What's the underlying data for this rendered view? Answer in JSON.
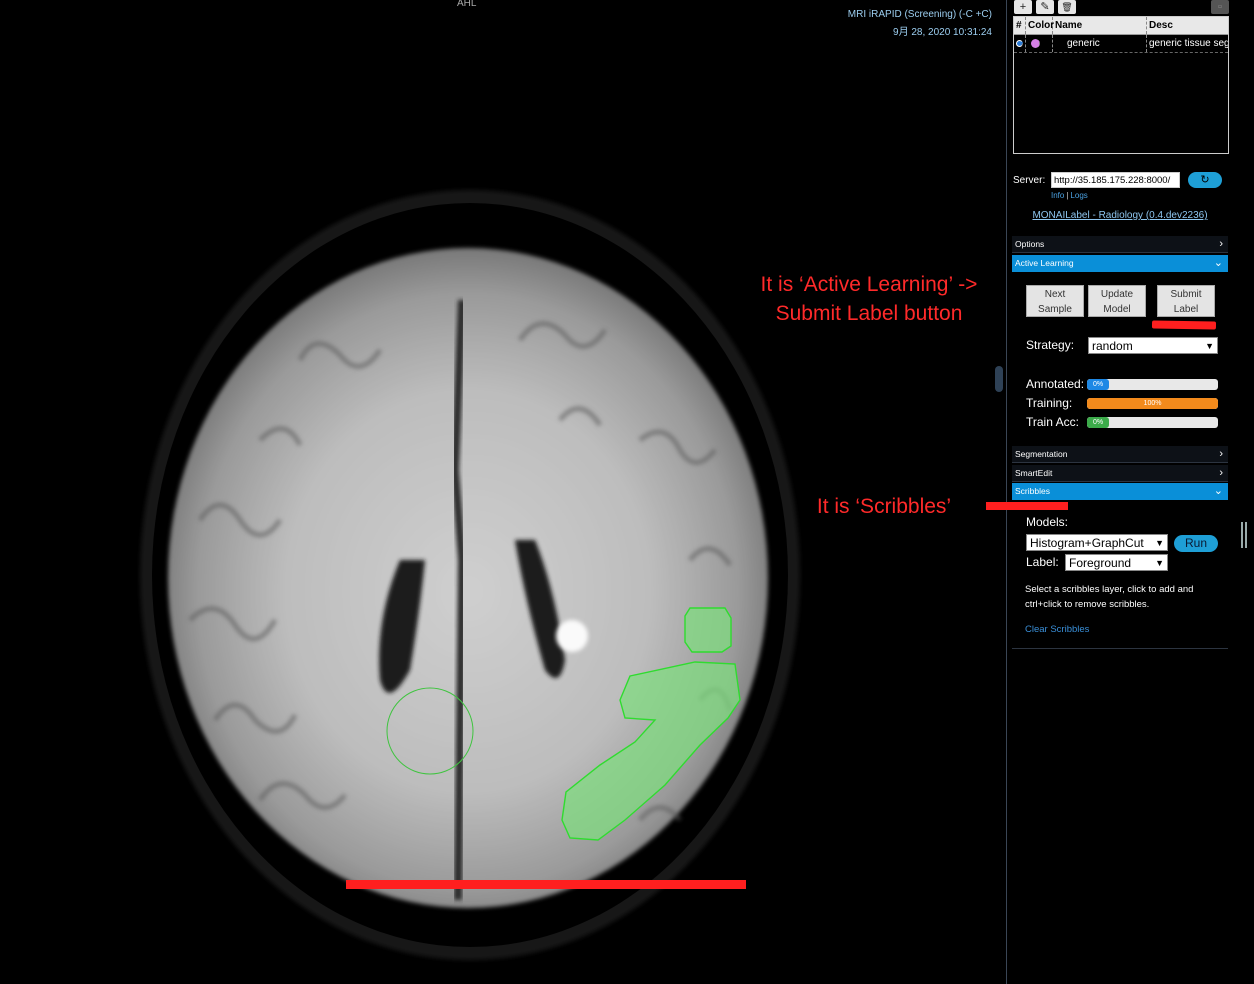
{
  "viewport": {
    "orientation_top": "AHL",
    "study_description": "MRI iRAPID (Screening) (-C +C)",
    "study_datetime": "9月 28, 2020 10:31:24"
  },
  "annotations": [
    {
      "text_line1": "It is ‘Active Learning’ ->",
      "text_line2": "Submit Label button"
    },
    {
      "text_line1": "It is ‘Scribbles’"
    }
  ],
  "toolbar": {
    "add_icon": "plus-icon",
    "edit_icon": "pencil-icon",
    "delete_icon": "trash-icon",
    "add_glyph": "+",
    "edit_glyph": "✎",
    "delete_glyph": "🗑"
  },
  "segments_table": {
    "headers": [
      "#",
      "Color",
      "Name",
      "Desc"
    ],
    "rows": [
      {
        "name": "generic",
        "desc": "generic tissue seg",
        "color": "#d580e6"
      }
    ]
  },
  "server": {
    "label": "Server:",
    "url": "http://35.185.175.228:8000/",
    "refresh_glyph": "↻",
    "info_link": "Info",
    "logs_link": "Logs",
    "separator": "|"
  },
  "app_link": "MONAILabel - Radiology (0.4.dev2236)",
  "sections": {
    "options": "Options",
    "active_learning": "Active Learning",
    "segmentation": "Segmentation",
    "smartedit": "SmartEdit",
    "scribbles": "Scribbles",
    "chevron_closed": "›",
    "chevron_open": "⌄"
  },
  "active_learning": {
    "next_sample_line1": "Next",
    "next_sample_line2": "Sample",
    "update_model_line1": "Update",
    "update_model_line2": "Model",
    "submit_label_line1": "Submit",
    "submit_label_line2": "Label",
    "strategy_label": "Strategy:",
    "strategy_value": "random",
    "annotated_label": "Annotated:",
    "annotated_value": "0%",
    "annotated_fraction": 0.0,
    "training_label": "Training:",
    "training_value": "100%",
    "training_fraction": 1.0,
    "train_acc_label": "Train Acc:",
    "train_acc_value": "0%",
    "train_acc_fraction": 0.0
  },
  "scribbles": {
    "models_label": "Models:",
    "model_value": "Histogram+GraphCut",
    "run_label": "Run",
    "label_label": "Label:",
    "label_value": "Foreground",
    "help_text": "Select a scribbles layer, click to add and ctrl+click to remove scribbles.",
    "clear_link": "Clear Scribbles"
  },
  "colors": {
    "accent": "#0a8fd8",
    "annotation_red": "#ff2a2a",
    "training_orange": "#f28a1c",
    "annotated_blue": "#1e88e5",
    "train_acc_green": "#3cab4a",
    "segment_green": "#78e078"
  }
}
